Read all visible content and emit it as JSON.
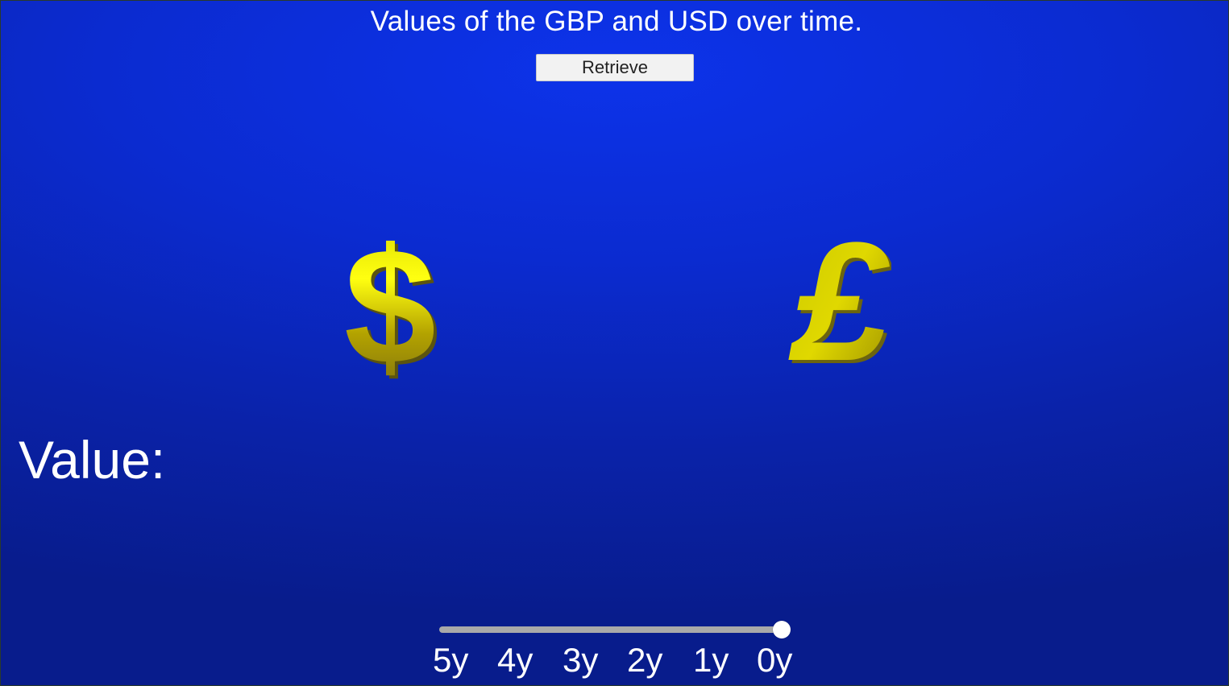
{
  "title": "Values of the GBP and USD over time.",
  "retrieve_button": {
    "label": "Retrieve"
  },
  "symbols": [
    {
      "name": "dollar-icon",
      "glyph": "$",
      "color": "#e6e600"
    },
    {
      "name": "pound-icon",
      "glyph": "£",
      "color": "#c8c800"
    }
  ],
  "value_label": "Value:",
  "slider": {
    "ticks": [
      "5y",
      "4y",
      "3y",
      "2y",
      "1y",
      "0y"
    ],
    "selected": "0y",
    "position": 1.0
  },
  "colors": {
    "background": "#0b2bd0",
    "text": "#ffffff",
    "gold": "#e6e600",
    "track": "#a9a9a9"
  }
}
